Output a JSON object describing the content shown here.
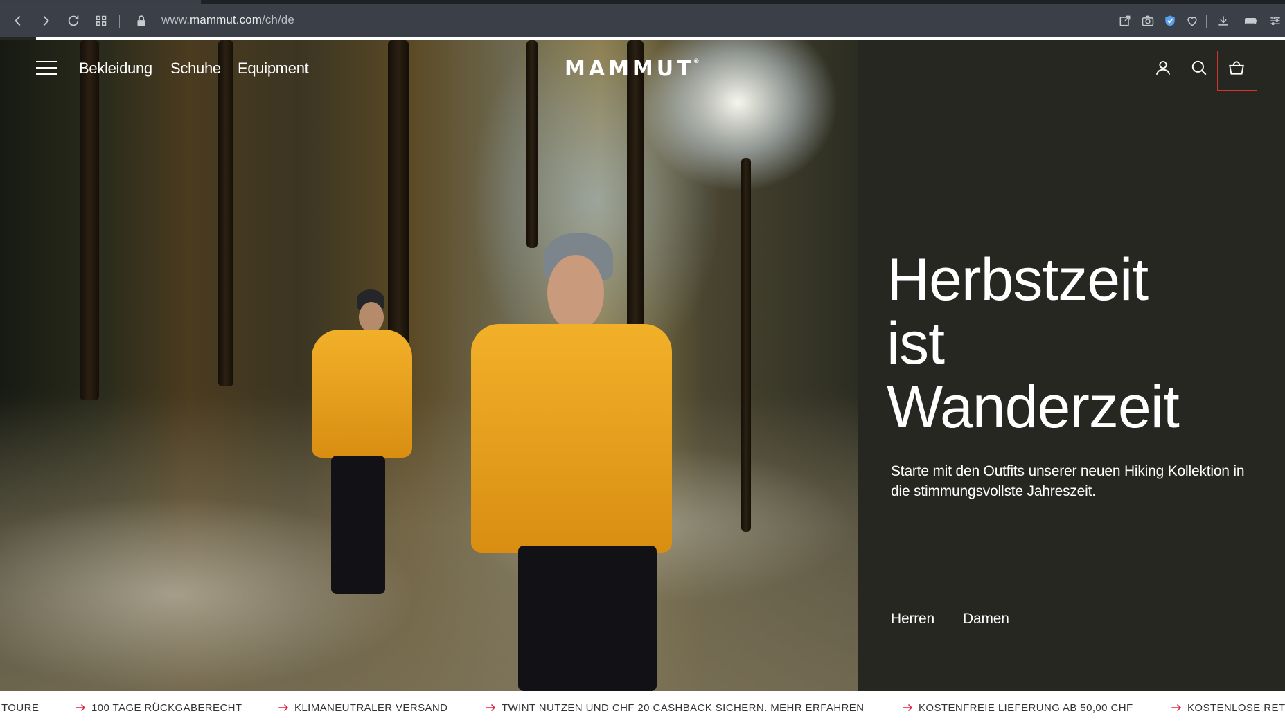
{
  "browser": {
    "url_prefix": "www.",
    "url_domain": "mammut.com",
    "url_path": "/ch/de"
  },
  "header": {
    "nav": [
      "Bekleidung",
      "Schuhe",
      "Equipment"
    ],
    "logo": "MAMMUT",
    "logo_mark": "®"
  },
  "hero": {
    "headline_lines": [
      "Herbstzeit",
      "ist",
      "Wanderzeit"
    ],
    "subtext": "Starte mit den Outfits unserer neuen Hiking Kollektion in die stimmungsvollste Jahreszeit.",
    "cta": [
      "Herren",
      "Damen"
    ]
  },
  "marquee": {
    "items": [
      "TOURE",
      "100 TAGE RÜCKGABERECHT",
      "KLIMANEUTRALER VERSAND",
      "TWINT NUTZEN UND CHF 20 CASHBACK SICHERN. MEHR ERFAHREN",
      "KOSTENFREIE LIEFERUNG AB 50,00 CHF",
      "KOSTENLOSE RET"
    ],
    "arrow_color": "#e2203a"
  },
  "colors": {
    "panel_bg": "#262721",
    "cart_highlight": "#d9312e",
    "browser_bar": "#3b4048"
  }
}
